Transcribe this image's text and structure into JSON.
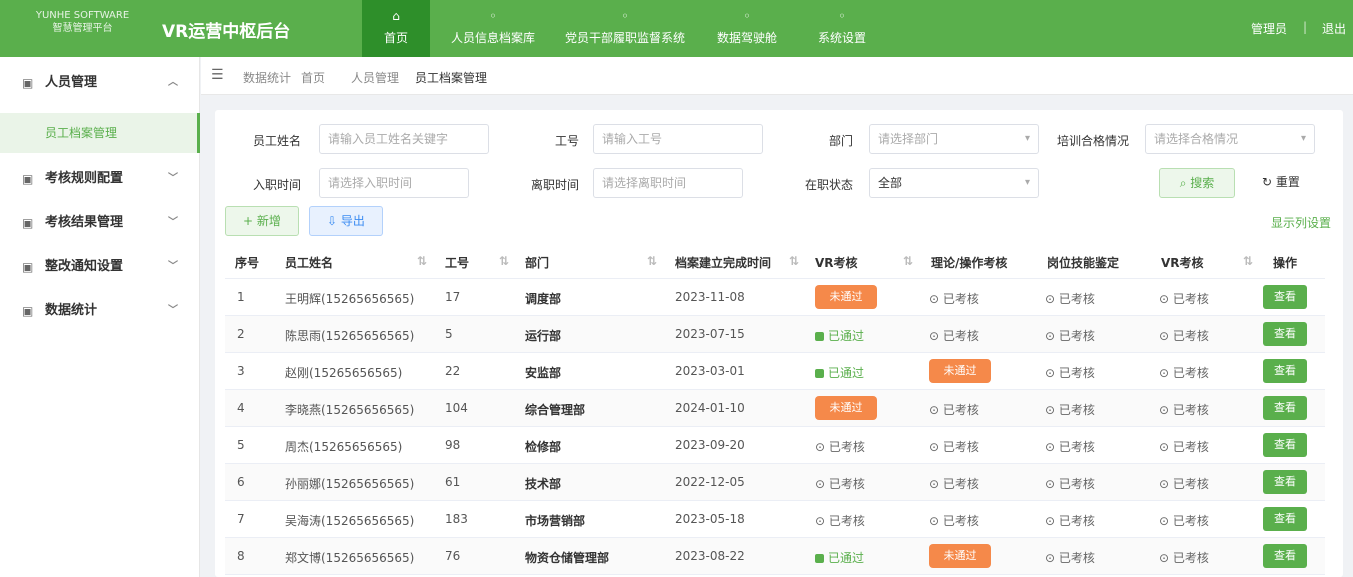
{
  "header": {
    "logo_line1": "YUNHE SOFTWARE",
    "logo_line2": "智慧管理平台",
    "system_title": "VR运营中枢后台",
    "tabs": [
      {
        "label": "首页",
        "icon": "home-icon",
        "active": true
      },
      {
        "label": "人员信息档案库",
        "icon": "person-icon",
        "active": false
      },
      {
        "label": "党员干部履职监督系统",
        "icon": "shield-icon",
        "active": false
      },
      {
        "label": "数据驾驶舱",
        "icon": "chart-icon",
        "active": false
      },
      {
        "label": "系统设置",
        "icon": "gear-icon",
        "active": false
      }
    ],
    "user_name": "管理员",
    "separator": "|",
    "logout_label": "退出"
  },
  "sidebar": {
    "groups": [
      {
        "label": "人员管理",
        "icon": "user-icon",
        "expanded": true
      },
      {
        "label": "考核规则配置",
        "icon": "list-icon",
        "expanded": false
      },
      {
        "label": "考核结果管理",
        "icon": "doc-icon",
        "expanded": false
      },
      {
        "label": "整改通知设置",
        "icon": "bell-icon",
        "expanded": false
      },
      {
        "label": "数据统计",
        "icon": "chart-icon",
        "expanded": false
      }
    ],
    "active_sub": "员工档案管理"
  },
  "breadcrumb": {
    "items": [
      "数据统计",
      "首页",
      "人员管理",
      "员工档案管理"
    ]
  },
  "filters": {
    "row1": [
      {
        "label": "员工姓名",
        "placeholder": "请输入员工姓名关键字"
      },
      {
        "label": "工号",
        "placeholder": "请输入工号"
      },
      {
        "label": "部门",
        "placeholder": "请选择部门"
      },
      {
        "label": "培训合格情况",
        "placeholder": "请选择合格情况"
      }
    ],
    "row2": [
      {
        "label": "入职时间",
        "placeholder": "请选择入职时间"
      },
      {
        "label": "离职时间",
        "placeholder": "请选择离职时间"
      },
      {
        "label": "在职状态",
        "value": "全部"
      }
    ],
    "search_label": "搜索",
    "reset_label": "重置"
  },
  "actions": {
    "add_label": "新增",
    "export_label": "导出",
    "column_settings_label": "显示列设置"
  },
  "table": {
    "columns": [
      "序号",
      "员工姓名",
      "工号",
      "部门",
      "档案建立完成时间",
      "VR考核",
      "理论/操作考核",
      "岗位技能鉴定",
      "VR考核",
      "操作"
    ],
    "rows": [
      {
        "no": "1",
        "name": "王明辉(15265656565)",
        "id": "17",
        "dept": "调度部",
        "date": "2023-11-08",
        "vr": {
          "type": "orange",
          "text": "未通过"
        },
        "theory": "已考核",
        "skill": "已考核",
        "vr2": "已考核",
        "op": "查看"
      },
      {
        "no": "2",
        "name": "陈思雨(15265656565)",
        "id": "5",
        "dept": "运行部",
        "date": "2023-07-15",
        "vr": {
          "type": "green",
          "text": "已通过"
        },
        "theory": "已考核",
        "skill": "已考核",
        "vr2": "已考核",
        "op": "查看"
      },
      {
        "no": "3",
        "name": "赵刚(15265656565)",
        "id": "22",
        "dept": "安监部",
        "date": "2023-03-01",
        "vr": {
          "type": "green",
          "text": "已通过"
        },
        "theory": {
          "type": "orange",
          "text": "未通过"
        },
        "skill": "已考核",
        "vr2": "已考核",
        "op": "查看"
      },
      {
        "no": "4",
        "name": "李晓燕(15265656565)",
        "id": "104",
        "dept": "综合管理部",
        "date": "2024-01-10",
        "vr": {
          "type": "orange",
          "text": "未通过"
        },
        "theory": "已考核",
        "skill": "已考核",
        "vr2": "已考核",
        "op": "查看"
      },
      {
        "no": "5",
        "name": "周杰(15265656565)",
        "id": "98",
        "dept": "检修部",
        "date": "2023-09-20",
        "vr": "已考核",
        "theory": "已考核",
        "skill": "已考核",
        "vr2": "已考核",
        "op": "查看"
      },
      {
        "no": "6",
        "name": "孙丽娜(15265656565)",
        "id": "61",
        "dept": "技术部",
        "date": "2022-12-05",
        "vr": "已考核",
        "theory": "已考核",
        "skill": "已考核",
        "vr2": "已考核",
        "op": "查看"
      },
      {
        "no": "7",
        "name": "吴海涛(15265656565)",
        "id": "183",
        "dept": "市场营销部",
        "date": "2023-05-18",
        "vr": "已考核",
        "theory": "已考核",
        "skill": "已考核",
        "vr2": "已考核",
        "op": "查看"
      },
      {
        "no": "8",
        "name": "郑文博(15265656565)",
        "id": "76",
        "dept": "物资仓储管理部",
        "date": "2023-08-22",
        "vr": {
          "type": "green",
          "text": "已通过"
        },
        "theory": {
          "type": "orange",
          "text": "未通过"
        },
        "skill": "已考核",
        "vr2": "已考核",
        "op": "查看"
      }
    ]
  },
  "colors": {
    "brand": "#5aaf4c",
    "brand_dark": "#2e8f2a",
    "warn": "#f5894a",
    "info": "#3b8cf2"
  }
}
